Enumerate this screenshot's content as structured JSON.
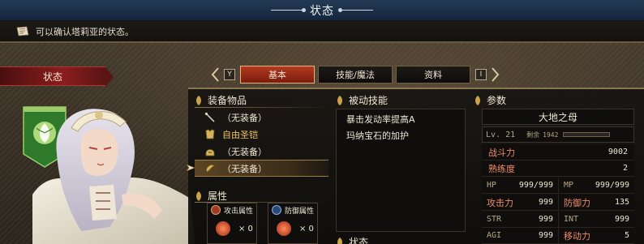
{
  "window": {
    "title": "状态"
  },
  "help": {
    "text": "可以确认塔莉亚的状态。",
    "icon": "note-icon"
  },
  "left": {
    "banner": "状态",
    "emblem_icon": "leaf-emblem-icon"
  },
  "tabs": {
    "left_key": "Y",
    "right_key": "I",
    "items": [
      {
        "label": "基本",
        "active": true
      },
      {
        "label": "技能/魔法",
        "active": false
      },
      {
        "label": "资料",
        "active": false
      }
    ]
  },
  "equipment": {
    "title": "装备物品",
    "items": [
      {
        "label": "（无装备）",
        "icon": "wand-icon",
        "color": "#efe6d2",
        "selected": false
      },
      {
        "label": "自由圣铠",
        "icon": "armor-icon",
        "color": "#f0c35a",
        "selected": false
      },
      {
        "label": "（无装备）",
        "icon": "helmet-icon",
        "color": "#efe6d2",
        "selected": false
      },
      {
        "label": "（无装备）",
        "icon": "ring-icon",
        "color": "#efe6d2",
        "selected": true
      }
    ]
  },
  "attributes": {
    "title": "属性",
    "attack": {
      "label": "攻击属性",
      "value": "× 0"
    },
    "defense": {
      "label": "防御属性",
      "value": "× 0"
    }
  },
  "passive": {
    "title": "被动技能",
    "items": [
      "暴击发动率提高A",
      "玛纳宝石的加护"
    ]
  },
  "params": {
    "title": "参数",
    "name": "大地之母",
    "level": "Lv. 21",
    "remaining_label": "剩余",
    "remaining_value": "1942",
    "exp_fraction": 0.0,
    "combat_label": "战斗力",
    "combat_value": "9002",
    "proficiency_label": "熟练度",
    "proficiency_value": "2",
    "hp_label": "HP",
    "hp_value": "999/999",
    "mp_label": "MP",
    "mp_value": "999/999",
    "atk_label": "攻击力",
    "atk_value": "999",
    "def_label": "防御力",
    "def_value": "135",
    "str_label": "STR",
    "str_value": "999",
    "int_label": "INT",
    "int_value": "999",
    "agi_label": "AGI",
    "agi_value": "999",
    "move_label": "移动力",
    "move_value": "5"
  },
  "status": {
    "title": "状态"
  },
  "colors": {
    "accent_red": "#8a1d1d",
    "gold": "#f0c35a",
    "stat_label": "#f08a6a"
  }
}
